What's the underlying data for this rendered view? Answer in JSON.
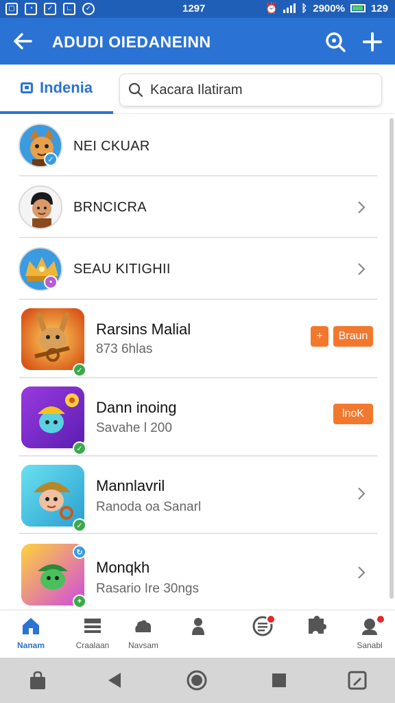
{
  "status_bar": {
    "time": "1297",
    "battery": "2900%",
    "signal_text": "129"
  },
  "app_bar": {
    "title": "ADUDI OIEDANEINN",
    "back_icon": "arrow-left-icon",
    "search_icon": "search-icon",
    "add_icon": "plus-icon"
  },
  "tab": {
    "label": "Indenia",
    "icon": "folder-icon"
  },
  "search": {
    "placeholder": "Kacara Ilatiram"
  },
  "simple_rows": [
    {
      "label": "NEI CKUAR",
      "has_chevron": false
    },
    {
      "label": "BRNCICRA",
      "has_chevron": true
    },
    {
      "label": "SEAU KITIGHII",
      "has_chevron": true
    }
  ],
  "app_rows": [
    {
      "title": "Rarsins Malial",
      "subtitle": "873 6hlas",
      "action": "plus-and-button",
      "plus_label": "+",
      "button_label": "Braun"
    },
    {
      "title": "Dann inoing",
      "subtitle": "Savahe l 200",
      "action": "button",
      "button_label": "lnoK"
    },
    {
      "title": "Mannlavril",
      "subtitle": "Ranoda oa Sanarl",
      "action": "chevron"
    },
    {
      "title": "Monqkh",
      "subtitle": "Rasario Ire 30ngs",
      "action": "chevron"
    }
  ],
  "bottom_nav": [
    {
      "label": "Nanam",
      "icon": "home-icon",
      "active": true
    },
    {
      "label": "Craalaan",
      "icon": "list-icon",
      "active": false
    },
    {
      "label": "Navsam",
      "icon": "cloud-icon",
      "active": false
    },
    {
      "label": "",
      "icon": "person-icon",
      "active": false
    },
    {
      "label": "",
      "icon": "chat-icon",
      "active": false
    },
    {
      "label": "",
      "icon": "puzzle-icon",
      "active": false
    },
    {
      "label": "Sanabl",
      "icon": "profile-icon",
      "active": false
    }
  ],
  "system_nav": [
    "bag-icon",
    "back-triangle-icon",
    "home-circle-icon",
    "recents-square-icon",
    "edit-icon"
  ],
  "colors": {
    "primary": "#2a73d4",
    "status_bar": "#1f5fb8",
    "accent_orange": "#f2782e",
    "badge_green": "#3ca94a",
    "badge_red": "#e52828"
  }
}
